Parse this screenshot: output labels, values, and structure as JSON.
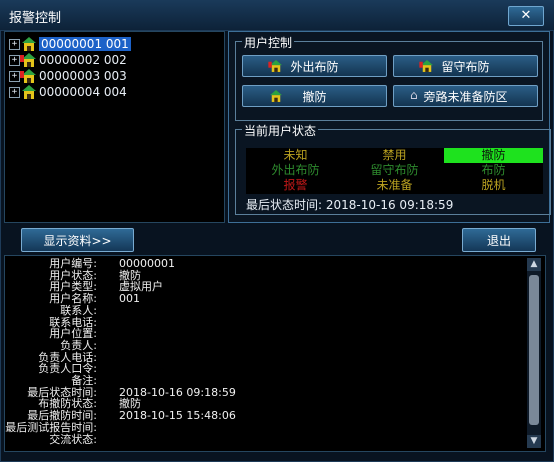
{
  "window": {
    "title": "报警控制",
    "close_label": "✕"
  },
  "tree": {
    "items": [
      {
        "label": "00000001  001",
        "selected": true
      },
      {
        "label": "00000002  002",
        "selected": false
      },
      {
        "label": "00000003  003",
        "selected": false
      },
      {
        "label": "00000004  004",
        "selected": false
      }
    ],
    "expander_label": "+"
  },
  "user_control": {
    "title": "用户控制",
    "buttons": {
      "away_arm": "外出布防",
      "stay_arm": "留守布防",
      "disarm": "撤防",
      "bypass": "旁路未准备防区"
    }
  },
  "current_status": {
    "title": "当前用户状态",
    "cells": [
      {
        "label": "未知",
        "color": "#b8a020",
        "bg": ""
      },
      {
        "label": "禁用",
        "color": "#b8a020",
        "bg": ""
      },
      {
        "label": "撤防",
        "color": "#0b1a0b",
        "bg": "#1ee21e"
      },
      {
        "label": "外出布防",
        "color": "#2e8b2e",
        "bg": ""
      },
      {
        "label": "留守布防",
        "color": "#2e8b2e",
        "bg": ""
      },
      {
        "label": "布防",
        "color": "#2e8b2e",
        "bg": ""
      },
      {
        "label": "报警",
        "color": "#c01818",
        "bg": ""
      },
      {
        "label": "未准备",
        "color": "#b8a020",
        "bg": ""
      },
      {
        "label": "脱机",
        "color": "#b8a020",
        "bg": ""
      }
    ],
    "last_time_label": "最后状态时间:",
    "last_time_value": "2018-10-16 09:18:59"
  },
  "buttons": {
    "show_info": "显示资料>>",
    "exit": "退出"
  },
  "info": {
    "rows": [
      {
        "k": "用户编号:",
        "v": "00000001"
      },
      {
        "k": "用户状态:",
        "v": "撤防"
      },
      {
        "k": "用户类型:",
        "v": "虚拟用户"
      },
      {
        "k": "用户名称:",
        "v": "001"
      },
      {
        "k": "联系人:",
        "v": ""
      },
      {
        "k": "联系电话:",
        "v": ""
      },
      {
        "k": "用户位置:",
        "v": ""
      },
      {
        "k": "负责人:",
        "v": ""
      },
      {
        "k": "负责人电话:",
        "v": ""
      },
      {
        "k": "负责人口令:",
        "v": ""
      },
      {
        "k": "备注:",
        "v": ""
      },
      {
        "k": "最后状态时间:",
        "v": "2018-10-16 09:18:59"
      },
      {
        "k": "布撤防状态:",
        "v": "撤防"
      },
      {
        "k": "最后撤防时间:",
        "v": "2018-10-15 15:48:06"
      },
      {
        "k": "最后测试报告时间:",
        "v": ""
      },
      {
        "k": "交流状态:",
        "v": ""
      }
    ],
    "scroll_up": "▲",
    "scroll_down": "▼"
  }
}
